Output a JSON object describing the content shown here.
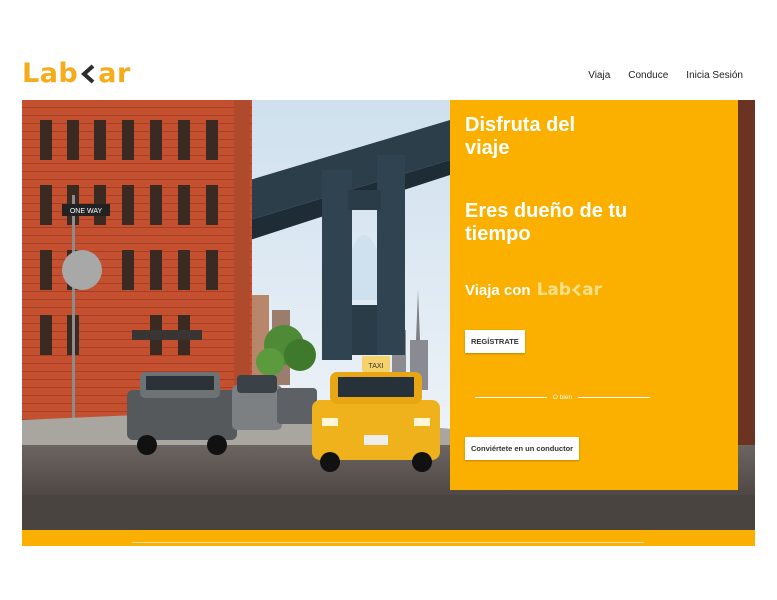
{
  "brand": {
    "name_left": "Lab",
    "name_right": "ar",
    "color": "#f5ac1b"
  },
  "nav": {
    "items": [
      "Viaja",
      "Conduce",
      "Inicia Sesión"
    ]
  },
  "hero": {
    "headline_1_line1": "Disfruta del",
    "headline_1_line2": "viaje",
    "headline_2_line1": "Eres dueño de tu",
    "headline_2_line2": "tiempo",
    "tagline": "Viaja con",
    "register_button": "REGÍSTRATE",
    "or_text": "O bien",
    "driver_button": "Conviértete en un conductor",
    "street_sign": "ONE WAY",
    "taxi_sign": "TAXI",
    "panel_color": "#fbb000"
  }
}
